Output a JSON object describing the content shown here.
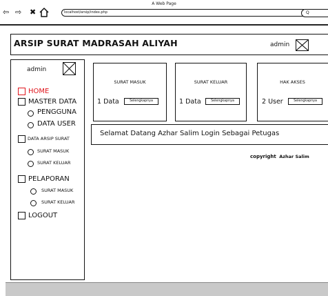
{
  "window": {
    "title": "A Web Page",
    "url": "localhost/arsip/index.php",
    "search_text": "Q"
  },
  "header": {
    "title": "ARSIP SURAT MADRASAH ALIYAH",
    "user": "admin"
  },
  "sidebar": {
    "user": "admin",
    "menu": {
      "home": "HOME",
      "master_data": "MASTER DATA",
      "pengguna": "PENGGUNA",
      "data_user": "DATA USER",
      "data_arsip_surat": "DATA ARSIP SURAT",
      "arsip_surat_masuk": "SURAT MASUK",
      "arsip_surat_keluar": "SURAT KELUAR",
      "pelaporan": "PELAPORAN",
      "laporan_surat_masuk": "SURAT MASUK",
      "laporan_surat_keluar": "SURAT KELUAR",
      "logout": "LOGOUT"
    },
    "active_color": "#e0141b"
  },
  "cards": [
    {
      "title": "SURAT MASUK",
      "count": "1 Data",
      "button": "Selengkapnya"
    },
    {
      "title": "SURAT KELUAR",
      "count": "1 Data",
      "button": "Selengkapnya"
    },
    {
      "title": "HAK AKSES",
      "count": "2 User",
      "button": "Selengkapnya"
    }
  ],
  "welcome": "Selamat Datang Azhar Salim Login Sebagai Petugas",
  "copyright": {
    "label": "copyright",
    "name": "Azhar Salim"
  }
}
